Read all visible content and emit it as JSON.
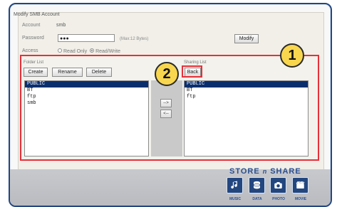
{
  "title": "Modify SMB Account",
  "account": {
    "label": "Account",
    "value": "smb"
  },
  "password": {
    "label": "Password",
    "value": "●●●",
    "hint": "(Max:12 Bytes)"
  },
  "access": {
    "label": "Access",
    "options": [
      "Read Only",
      "Read/Write"
    ],
    "selected": "Read/Write"
  },
  "buttons": {
    "modify": "Modify",
    "create": "Create",
    "rename": "Rename",
    "delete": "Delete",
    "back": "Back",
    "add": "-->",
    "remove": "<--"
  },
  "folder_list": {
    "label": "Folder List",
    "items": [
      "PUBLIC",
      "BT",
      "ftp",
      "smb"
    ],
    "selected_index": 0
  },
  "sharing_list": {
    "label": "Sharing List",
    "items": [
      "PUBLIC",
      "BT",
      "ftp"
    ],
    "selected_index": 0
  },
  "callouts": [
    "1",
    "2"
  ],
  "brand": {
    "store_left": "STORE",
    "store_mid": "n",
    "store_right": "SHARE",
    "icons": [
      {
        "label": "MUSIC",
        "icon": "music-icon"
      },
      {
        "label": "DATA",
        "icon": "database-icon"
      },
      {
        "label": "PHOTO",
        "icon": "camera-icon"
      },
      {
        "label": "MOVIE",
        "icon": "film-icon"
      }
    ]
  },
  "colors": {
    "frame": "#23467f",
    "highlight": "#e63039",
    "selection": "#0a2f6e",
    "badge": "#f8d64e",
    "brand": "#2c4f8f"
  }
}
